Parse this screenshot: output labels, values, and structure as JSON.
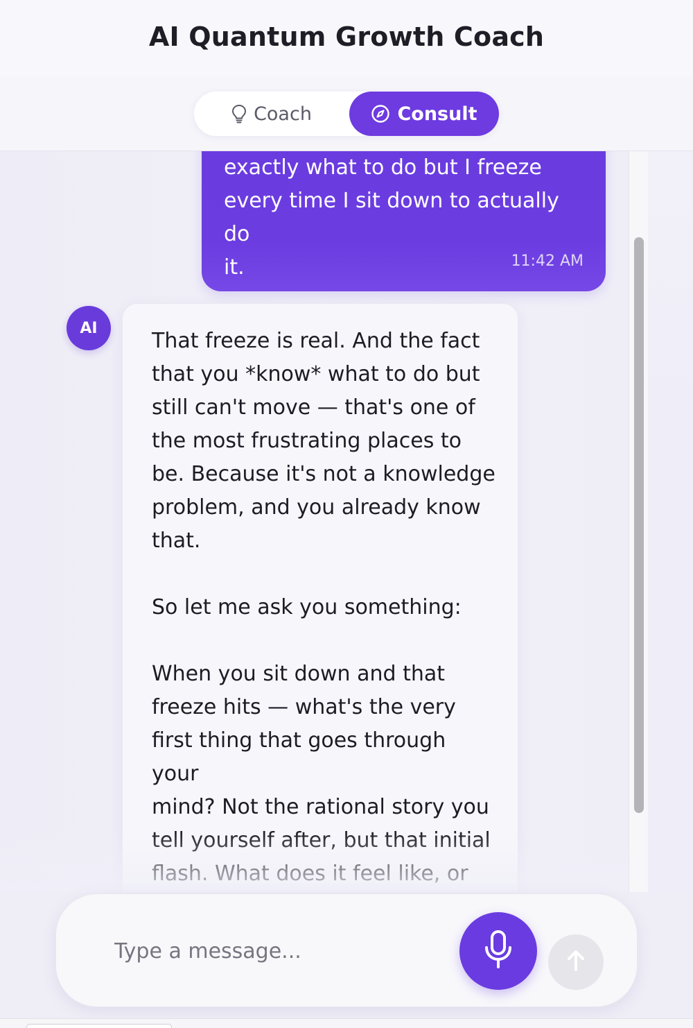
{
  "header": {
    "title": "AI Quantum Growth Coach"
  },
  "tabs": [
    {
      "label": "Coach",
      "icon": "lightbulb-icon",
      "active": false
    },
    {
      "label": "Consult",
      "icon": "compass-icon",
      "active": true
    }
  ],
  "messages": {
    "user": {
      "text": "exactly what to do but I freeze\nevery time I sit down to actually do\nit.",
      "time": "11:42 AM"
    },
    "ai": {
      "avatar": "AI",
      "text": "That freeze is real. And the fact\nthat you *know* what to do but\nstill can't move — that's one of\nthe most frustrating places to\nbe. Because it's not a knowledge\nproblem, and you already know\nthat.\n\nSo let me ask you something:\n\nWhen you sit down and that\nfreeze hits — what's the very\nfirst thing that goes through your\nmind? Not the rational story you\ntell yourself after, but that initial\nflash. What does it feel like, or\nsound like, right before you pull"
    }
  },
  "composer": {
    "placeholder": "Type a message...",
    "mic_icon": "microphone-icon",
    "send_icon": "arrow-up-icon"
  },
  "colors": {
    "accent": "#6d3be0",
    "send_disabled": "#e6e5ea"
  }
}
